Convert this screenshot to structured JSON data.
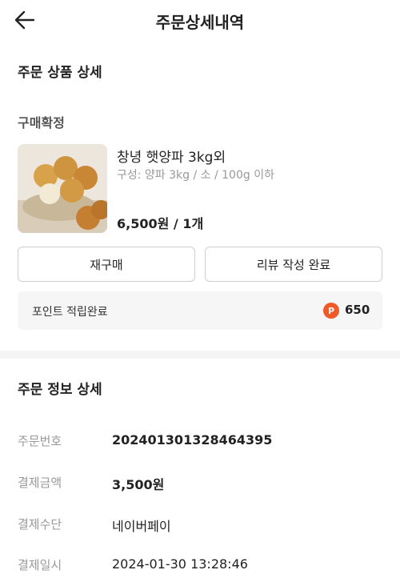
{
  "header": {
    "title": "주문상세내역"
  },
  "product_section": {
    "title": "주문 상품 상세",
    "status": "구매확정",
    "product": {
      "name": "창녕 햇양파 3kg외",
      "option": "구성: 양파 3kg / 소 / 100g 이하",
      "price_qty": "6,500원 / 1개"
    },
    "buttons": {
      "rebuy": "재구매",
      "review": "리뷰 작성 완료"
    },
    "points": {
      "label": "포인트 적립완료",
      "badge": "P",
      "value": "650"
    }
  },
  "info_section": {
    "title": "주문 정보 상세",
    "rows": [
      {
        "label": "주문번호",
        "value": "20240130132846439​5"
      },
      {
        "label": "결제금액",
        "value": "3,500원"
      },
      {
        "label": "결제수단",
        "value": "네이버페이"
      },
      {
        "label": "결제일시",
        "value": "2024-01-30 13:28:46"
      }
    ]
  },
  "colors": {
    "accent": "#f05a28",
    "muted": "#999999",
    "box_bg": "#f6f6f6"
  }
}
